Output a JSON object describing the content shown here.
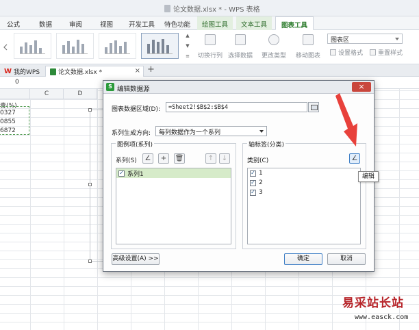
{
  "app": {
    "window_title": "论文数据.xlsx * - WPS 表格"
  },
  "ribbon": {
    "tabs": [
      "公式",
      "数据",
      "审阅",
      "视图",
      "开发工具",
      "特色功能",
      "绘图工具",
      "文本工具",
      "图表工具"
    ],
    "active_tab": "图表工具",
    "buttons": [
      "切换行列",
      "选择数据",
      "更改类型",
      "移动图表"
    ],
    "chart_area_select": "图表区",
    "small_buttons": [
      "设置格式",
      "重置样式"
    ]
  },
  "document_tabs": {
    "home": "我的WPS",
    "file": "论文数据.xlsx *",
    "new_tab_symbol": "+"
  },
  "formula_bar": {
    "value": "0"
  },
  "sheet": {
    "columns": [
      "C",
      "D"
    ],
    "cells": [
      "青(%)",
      "0327",
      "0855",
      "6872"
    ]
  },
  "dialog": {
    "title": "编辑数据源",
    "close_symbol": "×",
    "data_range_label": "图表数据区域(D):",
    "data_range_value": "=Sheet2!$B$2:$B$4",
    "series_direction_label": "系列生成方向:",
    "series_direction_value": "每列数据作为一个系列",
    "legend_group_title": "图例项(系列)",
    "series_label": "系列(S)",
    "series_items": [
      "系列1"
    ],
    "axis_group_title": "轴标签(分类)",
    "category_label": "类别(C)",
    "category_items": [
      "1",
      "2",
      "3"
    ],
    "advanced_button": "高级设置(A) >>",
    "ok_button": "确定",
    "cancel_button": "取消",
    "check_mark": "✓"
  },
  "tooltip": {
    "text": "编辑"
  },
  "watermark": {
    "text": "易采站长站",
    "url": "www.easck.com"
  },
  "colors": {
    "accent_green": "#2a7a2a",
    "selected_row": "#d6ebc9",
    "arrow_red": "#e8413b",
    "close_red": "#c9463c"
  }
}
